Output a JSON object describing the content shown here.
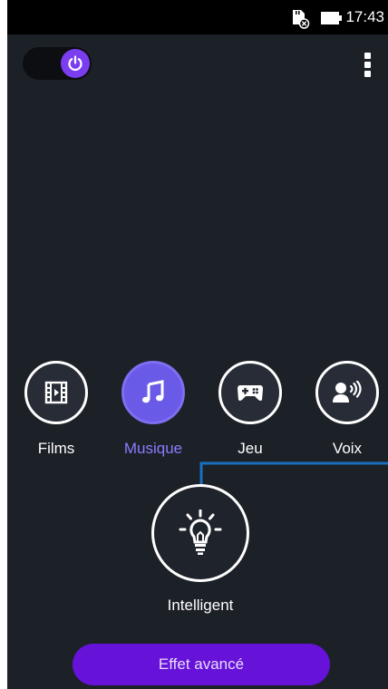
{
  "status_bar": {
    "time": "17:43",
    "icons": [
      "sd-card-removed-icon",
      "battery-icon"
    ]
  },
  "toolbar": {
    "power_toggle_state": "on",
    "power_icon": "power-icon",
    "menu_icon": "more-vertical-icon"
  },
  "modes": [
    {
      "label": "Films",
      "icon": "film-icon",
      "active": false
    },
    {
      "label": "Musique",
      "icon": "music-note-icon",
      "active": true
    },
    {
      "label": "Jeu",
      "icon": "gamepad-icon",
      "active": false
    },
    {
      "label": "Voix",
      "icon": "voice-icon",
      "active": false
    }
  ],
  "intelligent": {
    "label": "Intelligent",
    "icon": "lightbulb-icon"
  },
  "advanced": {
    "label": "Effet avancé"
  },
  "colors": {
    "background": "#1c2027",
    "accent": "#7a3df0",
    "active_mode": "#6a5ae8",
    "active_label": "#8a7cff",
    "button": "#6612d8",
    "connector": "#1a6fc0"
  }
}
